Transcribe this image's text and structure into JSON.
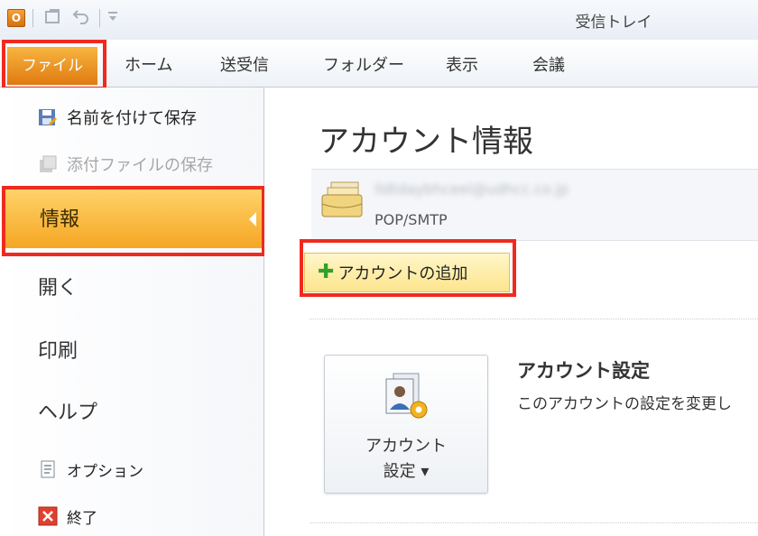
{
  "window": {
    "title": "受信トレイ"
  },
  "qat": {
    "app_icon_letter": "O",
    "icons": [
      "outlook-app-icon",
      "send-receive-icon",
      "undo-icon",
      "customize-qat-icon"
    ]
  },
  "ribbon": {
    "tabs": [
      "ファイル",
      "ホーム",
      "送受信",
      "フォルダー",
      "表示",
      "会議"
    ],
    "active_tab": "ファイル"
  },
  "backstage_nav": {
    "commands_top": [
      {
        "label": "名前を付けて保存",
        "icon": "save-as-icon",
        "enabled": true
      },
      {
        "label": "添付ファイルの保存",
        "icon": "save-attachments-icon",
        "enabled": false
      }
    ],
    "tabs": [
      "情報",
      "開く",
      "印刷",
      "ヘルプ"
    ],
    "active_tab": "情報",
    "commands_bottom": [
      {
        "label": "オプション",
        "icon": "options-icon"
      },
      {
        "label": "終了",
        "icon": "exit-icon"
      }
    ]
  },
  "info": {
    "title": "アカウント情報",
    "account": {
      "email": "lldtdaybhceel@udhcc.co.jp",
      "type": "POP/SMTP"
    },
    "add_account_label": "アカウントの追加",
    "account_settings": {
      "button_line1": "アカウント",
      "button_line2": "設定 ▾",
      "heading": "アカウント設定",
      "description": "このアカウントの設定を変更し"
    }
  },
  "colors": {
    "highlight_box": "#ef2a1e",
    "file_tab": "#e88a14",
    "active_nav": "#f5a623",
    "add_button": "#fde58e"
  }
}
